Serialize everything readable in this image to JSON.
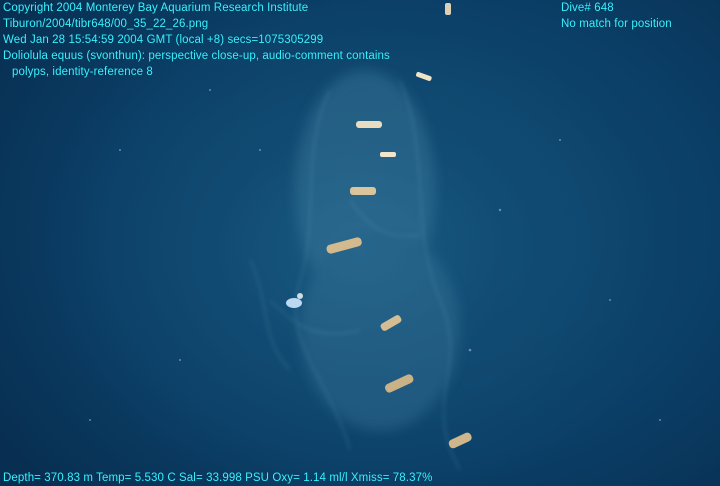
{
  "overlay": {
    "top_left": [
      "Copyright 2004 Monterey Bay Aquarium Research Institute",
      "Tiburon/2004/tibr648/00_35_22_26.png",
      "Wed Jan 28 15:54:59 2004 GMT (local +8)  secs=1075305299",
      "Doliolula equus (svonthun): perspective close-up, audio-comment contains",
      "polyps, identity-reference 8"
    ],
    "top_right": [
      "Dive# 648",
      "No match for position"
    ],
    "bottom": "Depth= 370.83 m  Temp= 5.530 C  Sal= 33.998 PSU  Oxy= 1.14 ml/l  Xmiss= 78.37%"
  },
  "colors": {
    "overlay_text": "#39f0ff",
    "water": "#0b3d63"
  }
}
